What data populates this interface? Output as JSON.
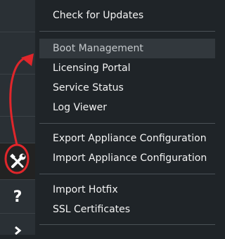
{
  "icons": {
    "wrench_screwdriver": "wrench-screwdriver-icon",
    "help": "question-mark-icon",
    "next": "chevron-right-icon"
  },
  "rail": {
    "help_glyph": "?"
  },
  "menu": {
    "groups": [
      [
        "Check for Updates"
      ],
      [
        "Boot Management",
        "Licensing Portal",
        "Service Status",
        "Log Viewer"
      ],
      [
        "Export Appliance Configuration",
        "Import Appliance Configuration"
      ],
      [
        "Import Hotfix",
        "SSL Certificates"
      ]
    ],
    "highlighted": "Boot Management"
  },
  "colors": {
    "menu_background": "#1f2428",
    "rail_background": "#2a3035",
    "highlight": "#32383d",
    "annotation": "#e0262b"
  }
}
